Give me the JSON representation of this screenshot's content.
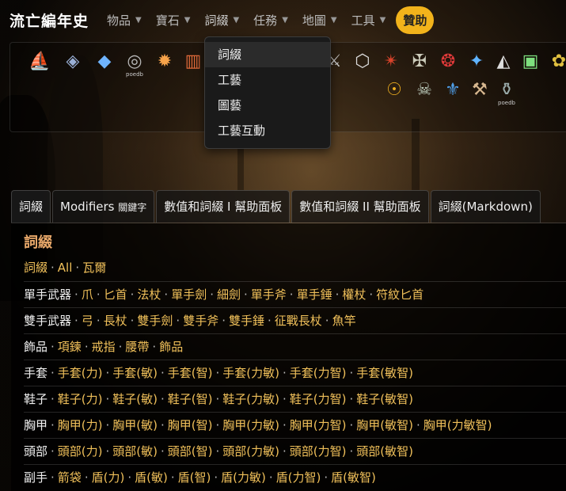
{
  "brand": "流亡編年史",
  "nav": [
    {
      "label": "物品"
    },
    {
      "label": "寶石"
    },
    {
      "label": "詞綴"
    },
    {
      "label": "任務"
    },
    {
      "label": "地圖"
    },
    {
      "label": "工具"
    }
  ],
  "sponsor": "贊助",
  "dropdown": [
    "詞綴",
    "工藝",
    "圖藝",
    "工藝互動"
  ],
  "icon_tags": [
    "poedb",
    "poedb"
  ],
  "tabs": [
    {
      "label": "詞綴"
    },
    {
      "label": "Modifiers",
      "sub": "關鍵字"
    },
    {
      "label": "數值和詞綴 I 幫助面板"
    },
    {
      "label": "數值和詞綴 II 幫助面板"
    },
    {
      "label": "詞綴(Markdown)"
    }
  ],
  "content_title": "詞綴",
  "rows": [
    {
      "label": "",
      "links": [
        "詞綴",
        "All",
        "瓦爾"
      ]
    },
    {
      "label": "單手武器",
      "links": [
        "爪",
        "匕首",
        "法杖",
        "單手劍",
        "細劍",
        "單手斧",
        "單手錘",
        "權杖",
        "符紋匕首"
      ]
    },
    {
      "label": "雙手武器",
      "links": [
        "弓",
        "長杖",
        "雙手劍",
        "雙手斧",
        "雙手錘",
        "征戰長杖",
        "魚竿"
      ]
    },
    {
      "label": "飾品",
      "links": [
        "項鍊",
        "戒指",
        "腰帶",
        "飾品"
      ]
    },
    {
      "label": "手套",
      "links": [
        "手套(力)",
        "手套(敏)",
        "手套(智)",
        "手套(力敏)",
        "手套(力智)",
        "手套(敏智)"
      ]
    },
    {
      "label": "鞋子",
      "links": [
        "鞋子(力)",
        "鞋子(敏)",
        "鞋子(智)",
        "鞋子(力敏)",
        "鞋子(力智)",
        "鞋子(敏智)"
      ]
    },
    {
      "label": "胸甲",
      "links": [
        "胸甲(力)",
        "胸甲(敏)",
        "胸甲(智)",
        "胸甲(力敏)",
        "胸甲(力智)",
        "胸甲(敏智)",
        "胸甲(力敏智)"
      ]
    },
    {
      "label": "頭部",
      "links": [
        "頭部(力)",
        "頭部(敏)",
        "頭部(智)",
        "頭部(力敏)",
        "頭部(力智)",
        "頭部(敏智)"
      ]
    },
    {
      "label": "副手",
      "links": [
        "箭袋",
        "盾(力)",
        "盾(敏)",
        "盾(智)",
        "盾(力敏)",
        "盾(力智)",
        "盾(敏智)"
      ]
    }
  ],
  "colors": {
    "accent": "#f2b31b",
    "link": "#f0c05a",
    "title": "#e8a86a"
  }
}
